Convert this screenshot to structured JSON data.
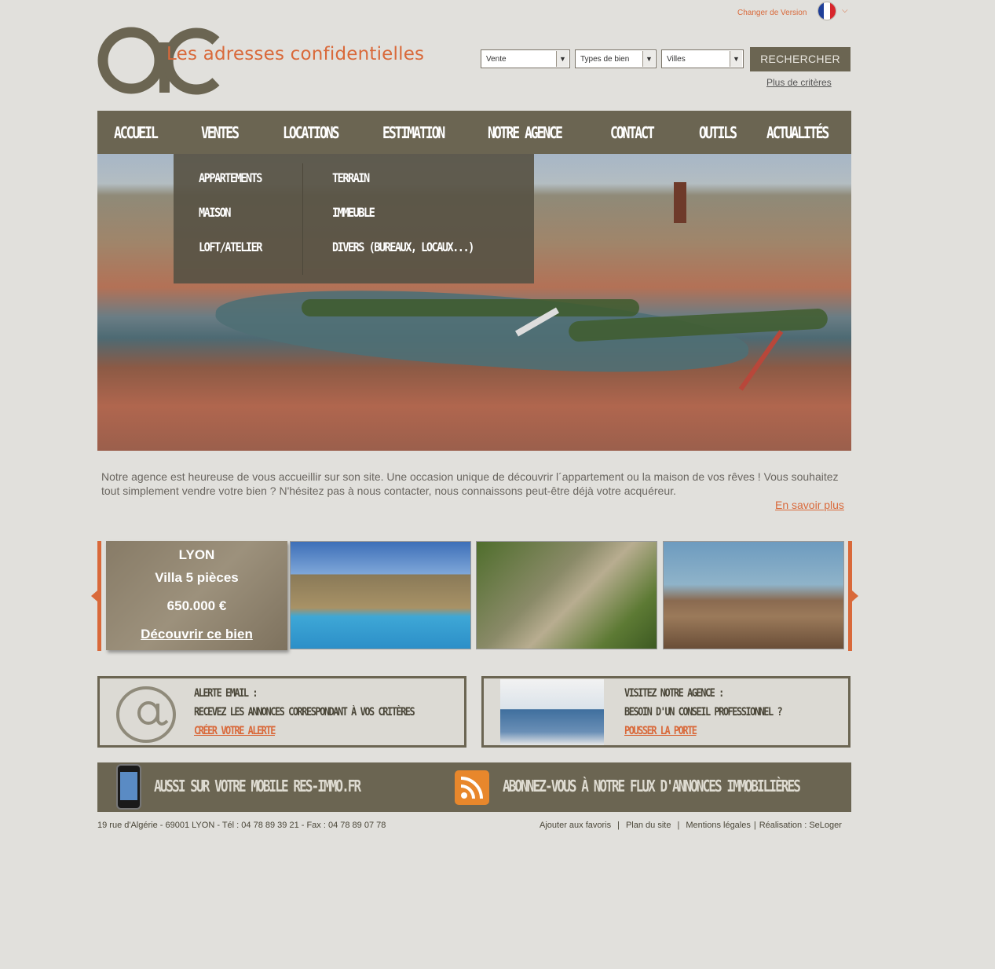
{
  "header": {
    "change_version": "Changer de Version",
    "flag_colors": [
      "#1f3f99",
      "#ffffff",
      "#d8262c"
    ],
    "logo_monogram": "ac",
    "logo_text": "Les adresses confidentielles"
  },
  "search": {
    "type_select": "Vente",
    "property_select": "Types de bien",
    "city_select": "Villes",
    "button": "RECHERCHER",
    "more_criteria": "Plus de critères"
  },
  "nav": {
    "items": [
      "ACCUEIL",
      "VENTES",
      "LOCATIONS",
      "ESTIMATION",
      "NOTRE AGENCE",
      "CONTACT",
      "OUTILS",
      "ACTUALITÉS"
    ]
  },
  "dropdown": {
    "col1": [
      "APPARTEMENTS",
      "MAISON",
      "LOFT/ATELIER"
    ],
    "col2": [
      "TERRAIN",
      "IMMEUBLE",
      "DIVERS (BUREAUX, LOCAUX...)"
    ]
  },
  "intro": {
    "text": "Notre agence est heureuse de vous accueillir sur son site. Une occasion unique de découvrir l´appartement ou la maison de vos rêves ! Vous souhaitez tout simplement vendre votre bien ? N'hésitez pas à nous contacter, nous connaissons peut-être déjà votre acquéreur.",
    "learn_more": "En savoir plus"
  },
  "featured": {
    "city": "LYON",
    "title": "Villa 5 pièces",
    "price": "650.000 €",
    "cta": "Découvrir ce bien"
  },
  "alert_box": {
    "title": "ALERTE EMAIL :",
    "text": "RECEVEZ LES ANNONCES CORRESPONDANT À VOS CRITÈRES",
    "link": "CRÉER VOTRE ALERTE"
  },
  "agency_box": {
    "title": "VISITEZ NOTRE AGENCE :",
    "text": "BESOIN D'UN CONSEIL PROFESSIONNEL ?",
    "link": "POUSSER LA PORTE"
  },
  "banner": {
    "mobile": "AUSSI SUR VOTRE  MOBILE RES-IMMO.FR",
    "rss": "ABONNEZ-VOUS À NOTRE  FLUX D'ANNONCES IMMOBILIÈRES"
  },
  "footer": {
    "address": "19 rue d'Algérie - 69001 LYON  -  Tél : 04 78 89 39 21 - Fax : 04 78 89 07 78",
    "links": [
      "Ajouter aux favoris",
      "Plan du site",
      "Mentions légales",
      "Réalisation : SeLoger"
    ]
  },
  "colors": {
    "accent": "#d9693a",
    "brand": "#6b6552",
    "background": "#e1e0dc"
  }
}
